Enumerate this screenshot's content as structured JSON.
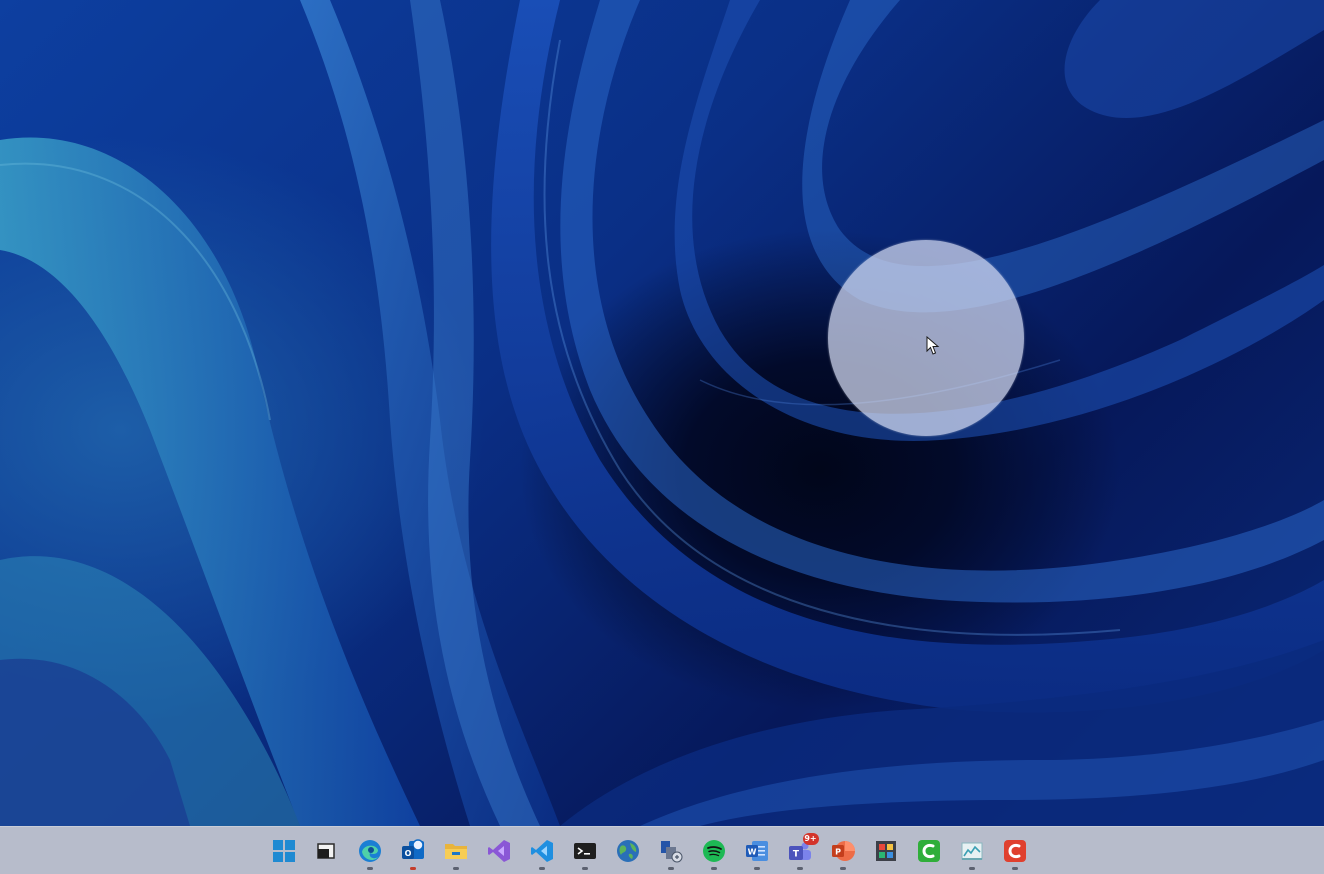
{
  "colors": {
    "taskbar_bg": "#b7bccb",
    "wallpaper_primary": "#0d3fa0",
    "wallpaper_dark": "#020a2a",
    "highlight": "rgba(215,222,245,0.72)",
    "running_indicator": "#5c6170",
    "active_indicator": "#c43d2b"
  },
  "taskbar": {
    "items": [
      {
        "icon": "windows-start-icon",
        "running": false
      },
      {
        "icon": "task-view-icon",
        "running": false
      },
      {
        "icon": "edge-browser-icon",
        "running": true
      },
      {
        "icon": "outlook-icon",
        "running": true,
        "active": true
      },
      {
        "icon": "file-explorer-icon",
        "running": true
      },
      {
        "icon": "visual-studio-icon",
        "running": false
      },
      {
        "icon": "vscode-icon",
        "running": true
      },
      {
        "icon": "terminal-icon",
        "running": true
      },
      {
        "icon": "globe-icon",
        "running": false
      },
      {
        "icon": "remote-tool-icon",
        "running": true
      },
      {
        "icon": "spotify-icon",
        "running": true
      },
      {
        "icon": "word-icon",
        "running": true
      },
      {
        "icon": "teams-icon",
        "running": true,
        "badge": "9+"
      },
      {
        "icon": "powerpoint-icon",
        "running": true
      },
      {
        "icon": "app-grid-icon",
        "running": false
      },
      {
        "icon": "camtasia-icon",
        "running": false
      },
      {
        "icon": "chart-app-icon",
        "running": true
      },
      {
        "icon": "camtasia-red-icon",
        "running": true
      }
    ]
  }
}
